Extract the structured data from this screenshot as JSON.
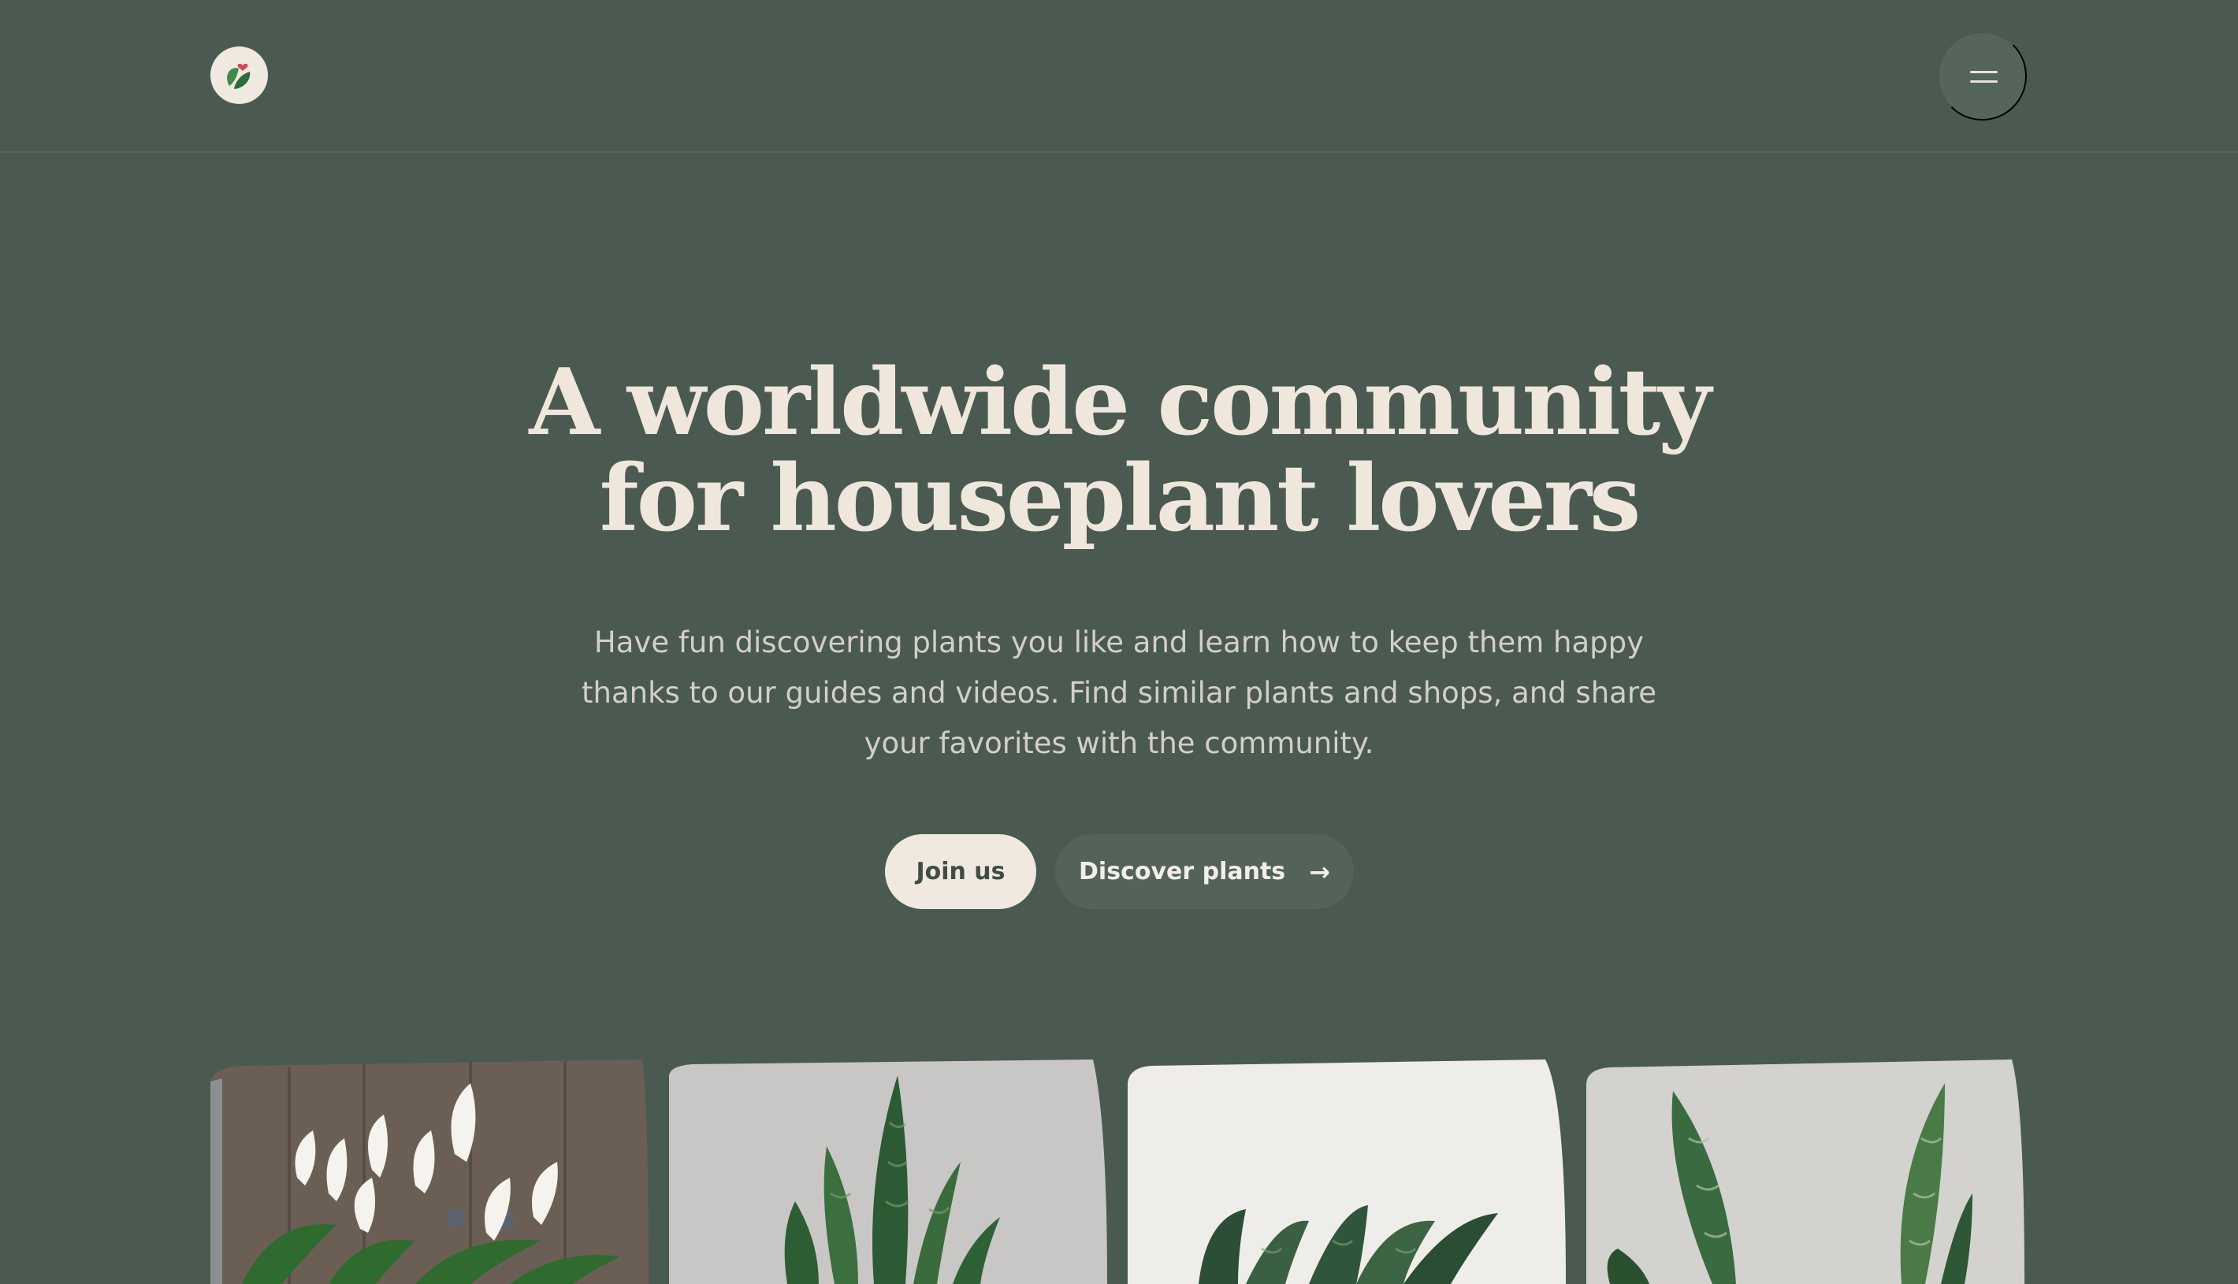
{
  "header": {
    "logo_icon": "plant-heart-logo-icon",
    "menu_icon": "hamburger-menu-icon"
  },
  "hero": {
    "title_line1": "A worldwide community",
    "title_line2": "for houseplant lovers",
    "subtitle_line1": "Have fun discovering plants you like and learn how to keep them happy",
    "subtitle_line2": "thanks to our guides and videos. Find similar plants and shops, and share",
    "subtitle_line3": "your favorites with the community."
  },
  "actions": {
    "join_label": "Join us",
    "discover_label": "Discover plants",
    "discover_icon": "arrow-right-icon"
  },
  "plant_cards": [
    {
      "image": "peace-lily-photo"
    },
    {
      "image": "snake-plant-photo"
    },
    {
      "image": "snake-plant-rosette-photo"
    },
    {
      "image": "snake-plant-tall-photo"
    }
  ],
  "colors": {
    "background": "#4a5a51",
    "text_light": "#efe7dc",
    "button_light": "#efe9df",
    "button_dark": "#53635a"
  }
}
